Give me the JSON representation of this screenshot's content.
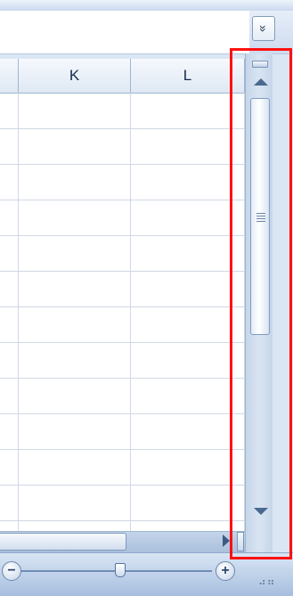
{
  "formula_bar": {
    "expand_icon": "double-chevron-down-icon",
    "expand_glyph": "»"
  },
  "columns": [
    {
      "label": "K"
    },
    {
      "label": "L"
    }
  ],
  "zoom": {
    "minus_glyph": "−",
    "plus_glyph": "+"
  },
  "colors": {
    "highlight": "#ff1010",
    "header_text": "#15294b"
  }
}
